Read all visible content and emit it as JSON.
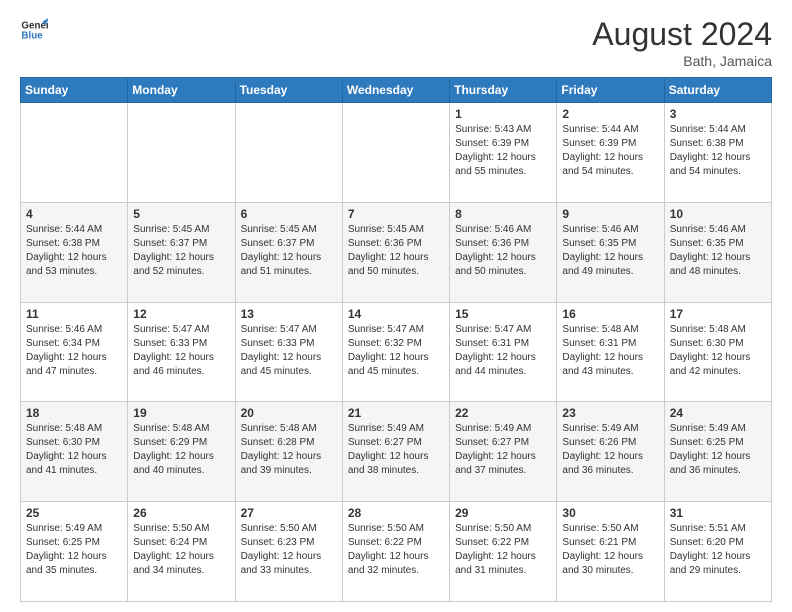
{
  "logo": {
    "line1": "General",
    "line2": "Blue"
  },
  "header": {
    "month": "August 2024",
    "location": "Bath, Jamaica"
  },
  "weekdays": [
    "Sunday",
    "Monday",
    "Tuesday",
    "Wednesday",
    "Thursday",
    "Friday",
    "Saturday"
  ],
  "weeks": [
    [
      {
        "day": "",
        "sunrise": "",
        "sunset": "",
        "daylight": ""
      },
      {
        "day": "",
        "sunrise": "",
        "sunset": "",
        "daylight": ""
      },
      {
        "day": "",
        "sunrise": "",
        "sunset": "",
        "daylight": ""
      },
      {
        "day": "",
        "sunrise": "",
        "sunset": "",
        "daylight": ""
      },
      {
        "day": "1",
        "sunrise": "Sunrise: 5:43 AM",
        "sunset": "Sunset: 6:39 PM",
        "daylight": "Daylight: 12 hours and 55 minutes."
      },
      {
        "day": "2",
        "sunrise": "Sunrise: 5:44 AM",
        "sunset": "Sunset: 6:39 PM",
        "daylight": "Daylight: 12 hours and 54 minutes."
      },
      {
        "day": "3",
        "sunrise": "Sunrise: 5:44 AM",
        "sunset": "Sunset: 6:38 PM",
        "daylight": "Daylight: 12 hours and 54 minutes."
      }
    ],
    [
      {
        "day": "4",
        "sunrise": "Sunrise: 5:44 AM",
        "sunset": "Sunset: 6:38 PM",
        "daylight": "Daylight: 12 hours and 53 minutes."
      },
      {
        "day": "5",
        "sunrise": "Sunrise: 5:45 AM",
        "sunset": "Sunset: 6:37 PM",
        "daylight": "Daylight: 12 hours and 52 minutes."
      },
      {
        "day": "6",
        "sunrise": "Sunrise: 5:45 AM",
        "sunset": "Sunset: 6:37 PM",
        "daylight": "Daylight: 12 hours and 51 minutes."
      },
      {
        "day": "7",
        "sunrise": "Sunrise: 5:45 AM",
        "sunset": "Sunset: 6:36 PM",
        "daylight": "Daylight: 12 hours and 50 minutes."
      },
      {
        "day": "8",
        "sunrise": "Sunrise: 5:46 AM",
        "sunset": "Sunset: 6:36 PM",
        "daylight": "Daylight: 12 hours and 50 minutes."
      },
      {
        "day": "9",
        "sunrise": "Sunrise: 5:46 AM",
        "sunset": "Sunset: 6:35 PM",
        "daylight": "Daylight: 12 hours and 49 minutes."
      },
      {
        "day": "10",
        "sunrise": "Sunrise: 5:46 AM",
        "sunset": "Sunset: 6:35 PM",
        "daylight": "Daylight: 12 hours and 48 minutes."
      }
    ],
    [
      {
        "day": "11",
        "sunrise": "Sunrise: 5:46 AM",
        "sunset": "Sunset: 6:34 PM",
        "daylight": "Daylight: 12 hours and 47 minutes."
      },
      {
        "day": "12",
        "sunrise": "Sunrise: 5:47 AM",
        "sunset": "Sunset: 6:33 PM",
        "daylight": "Daylight: 12 hours and 46 minutes."
      },
      {
        "day": "13",
        "sunrise": "Sunrise: 5:47 AM",
        "sunset": "Sunset: 6:33 PM",
        "daylight": "Daylight: 12 hours and 45 minutes."
      },
      {
        "day": "14",
        "sunrise": "Sunrise: 5:47 AM",
        "sunset": "Sunset: 6:32 PM",
        "daylight": "Daylight: 12 hours and 45 minutes."
      },
      {
        "day": "15",
        "sunrise": "Sunrise: 5:47 AM",
        "sunset": "Sunset: 6:31 PM",
        "daylight": "Daylight: 12 hours and 44 minutes."
      },
      {
        "day": "16",
        "sunrise": "Sunrise: 5:48 AM",
        "sunset": "Sunset: 6:31 PM",
        "daylight": "Daylight: 12 hours and 43 minutes."
      },
      {
        "day": "17",
        "sunrise": "Sunrise: 5:48 AM",
        "sunset": "Sunset: 6:30 PM",
        "daylight": "Daylight: 12 hours and 42 minutes."
      }
    ],
    [
      {
        "day": "18",
        "sunrise": "Sunrise: 5:48 AM",
        "sunset": "Sunset: 6:30 PM",
        "daylight": "Daylight: 12 hours and 41 minutes."
      },
      {
        "day": "19",
        "sunrise": "Sunrise: 5:48 AM",
        "sunset": "Sunset: 6:29 PM",
        "daylight": "Daylight: 12 hours and 40 minutes."
      },
      {
        "day": "20",
        "sunrise": "Sunrise: 5:48 AM",
        "sunset": "Sunset: 6:28 PM",
        "daylight": "Daylight: 12 hours and 39 minutes."
      },
      {
        "day": "21",
        "sunrise": "Sunrise: 5:49 AM",
        "sunset": "Sunset: 6:27 PM",
        "daylight": "Daylight: 12 hours and 38 minutes."
      },
      {
        "day": "22",
        "sunrise": "Sunrise: 5:49 AM",
        "sunset": "Sunset: 6:27 PM",
        "daylight": "Daylight: 12 hours and 37 minutes."
      },
      {
        "day": "23",
        "sunrise": "Sunrise: 5:49 AM",
        "sunset": "Sunset: 6:26 PM",
        "daylight": "Daylight: 12 hours and 36 minutes."
      },
      {
        "day": "24",
        "sunrise": "Sunrise: 5:49 AM",
        "sunset": "Sunset: 6:25 PM",
        "daylight": "Daylight: 12 hours and 36 minutes."
      }
    ],
    [
      {
        "day": "25",
        "sunrise": "Sunrise: 5:49 AM",
        "sunset": "Sunset: 6:25 PM",
        "daylight": "Daylight: 12 hours and 35 minutes."
      },
      {
        "day": "26",
        "sunrise": "Sunrise: 5:50 AM",
        "sunset": "Sunset: 6:24 PM",
        "daylight": "Daylight: 12 hours and 34 minutes."
      },
      {
        "day": "27",
        "sunrise": "Sunrise: 5:50 AM",
        "sunset": "Sunset: 6:23 PM",
        "daylight": "Daylight: 12 hours and 33 minutes."
      },
      {
        "day": "28",
        "sunrise": "Sunrise: 5:50 AM",
        "sunset": "Sunset: 6:22 PM",
        "daylight": "Daylight: 12 hours and 32 minutes."
      },
      {
        "day": "29",
        "sunrise": "Sunrise: 5:50 AM",
        "sunset": "Sunset: 6:22 PM",
        "daylight": "Daylight: 12 hours and 31 minutes."
      },
      {
        "day": "30",
        "sunrise": "Sunrise: 5:50 AM",
        "sunset": "Sunset: 6:21 PM",
        "daylight": "Daylight: 12 hours and 30 minutes."
      },
      {
        "day": "31",
        "sunrise": "Sunrise: 5:51 AM",
        "sunset": "Sunset: 6:20 PM",
        "daylight": "Daylight: 12 hours and 29 minutes."
      }
    ]
  ]
}
